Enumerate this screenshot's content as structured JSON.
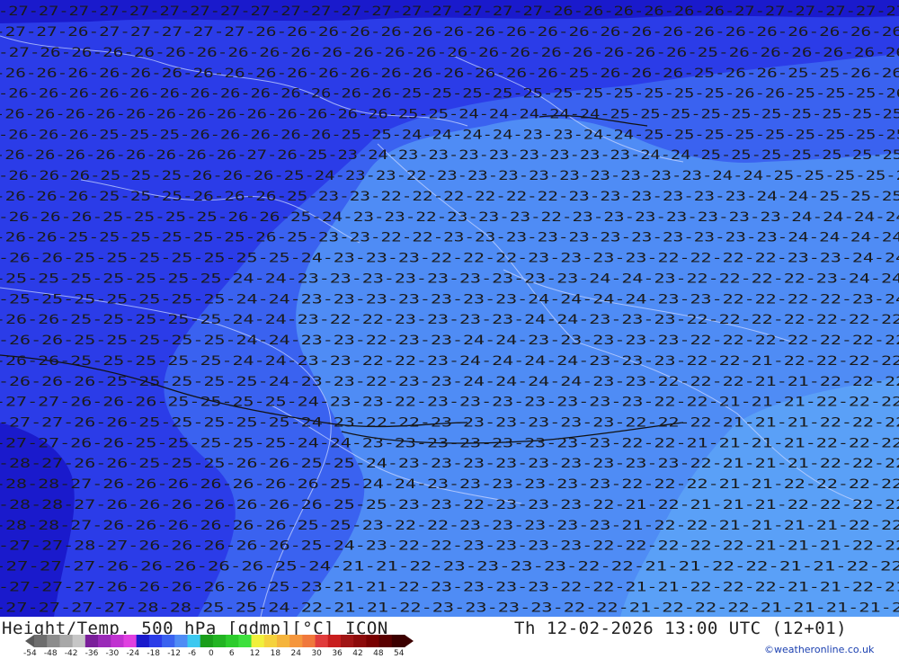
{
  "map": {
    "field": "500 hPa geopotential temperature",
    "colors": {
      "cold_deep": "#1a1acc",
      "cold_mid": "#2b3ce8",
      "blue": "#3a62f0",
      "light_blue": "#4f8cf5",
      "lighter_blue": "#5aa0f7",
      "border_line": "#c9d6ff",
      "contour_line": "#000000"
    },
    "label_rows": [
      "-27-27-27-27-27-27-27-27-27-27-27-27-27-27-27-27-27-27-26-26-26-26-26-26-27-27-27-27-27-27",
      "-27-27-26-27-27-27-27-27-26-26-26-26-26-26-26-26-26-26-26-26-26-26-26-26-26-26-26-26-26",
      "-27-26-26-26-26-26-26-26-26-26-26-26-26-26-26-26-26-26-26-26-26-26-25-26-26-26-26-26-26",
      "-26-26-26-26-26-26-26-26-26-26-26-26-26-26-26-26-26-26-25-26-26-26-25-26-26-25-25-26-26",
      "-26-26-26-26-26-26-26-26-26-26-26-26-26-25-25-25-25-25-25-25-25-25-25-25-26-26-25-25-25-26",
      "-26-26-26-26-26-26-26-26-26-26-26-26-26-25-25-24-24-24-24-24-25-25-25-25-25-25-25-25-25-25",
      "-26-26-26-25-25-25-26-26-26-26-26-25-25-24-24-24-24-23-23-24-24-25-25-25-25-25-25-25-25-25",
      "-26-26-26-26-26-26-26-26-27-26-25-23-24-23-23-23-23-23-23-23-23-24-24-25-25-25-25-25-25-25",
      "-26-26-26-25-25-25-26-26-26-25-24-23-23-22-23-23-23-23-23-23-23-23-23-24-24-25-25-25-25-2",
      "-26-26-26-25-25-25-26-26-26-25-23-23-22-22-22-22-22-22-23-23-23-23-23-23-24-24-25-25-25",
      "-26-26-26-25-25-25-25-26-26-25-24-23-23-22-23-23-23-22-23-23-23-23-23-23-23-24-24-24-24",
      "-26-26-25-25-25-25-25-25-26-25-23-23-22-22-23-23-23-23-23-23-23-23-23-23-23-24-24-24-24",
      "-26-26-25-25-25-25-25-25-25-24-23-23-23-22-22-22-23-23-23-23-22-22-22-22-23-23-24-24",
      "-25-25-25-25-25-25-25-24-24-23-23-23-23-23-23-23-23-23-24-24-23-22-22-22-22-23-24-24",
      "-25-25-25-25-25-25-25-24-24-23-23-23-23-23-23-23-24-24-24-24-23-23-22-22-22-22-23-24",
      "-26-26-25-25-25-25-25-24-24-23-22-22-23-23-23-23-24-24-23-23-23-22-22-22-22-22-22-22",
      "-26-26-25-25-25-25-25-24-24-23-23-22-23-23-24-24-23-23-23-23-23-22-22-22-22-22-22-22",
      "-26-26-25-25-25-25-25-24-24-23-23-22-22-23-24-24-24-24-23-23-23-22-22-21-22-22-22-22",
      "-26-26-26-25-25-25-25-25-24-23-23-22-23-23-24-24-24-24-23-23-22-22-22-21-21-22-22-22",
      "-27-27-26-26-26-25-25-25-25-24-23-23-22-23-23-23-23-23-23-23-22-22-21-21-21-22-22-22",
      "-27-27-26-26-25-25-25-25-25-24-23-22-22-23-23-23-23-23-23-22-22-22-21-21-21-22-22-22",
      "-27-27-26-26-25-25-25-25-25-24-24-23-23-23-23-23-23-23-23-22-22-21-21-21-21-22-22-22",
      "-28-27-26-26-25-25-25-26-26-25-25-24-23-23-23-23-23-23-23-23-23-22-21-21-21-22-22-22",
      "-28-28-27-26-26-26-26-26-26-26-25-24-24-23-23-23-23-23-23-22-22-22-21-21-22-22-22-22",
      "-28-28-27-26-26-26-26-26-26-26-25-25-23-23-22-23-23-23-22-21-22-21-21-21-22-22-22-22",
      "-28-28-27-26-26-26-26-26-26-25-25-23-22-22-23-23-23-23-23-21-22-22-21-21-21-21-22-22",
      "-27-27-28-27-26-26-26-26-26-25-24-23-22-22-23-23-23-23-22-22-22-22-22-21-21-21-22-22",
      "-27-27-27-26-26-26-26-26-25-24-21-21-22-23-23-23-23-22-22-21-21-22-22-21-21-22-22",
      "-27-27-27-26-26-26-26-26-25-23-21-21-22-23-23-23-23-22-22-21-21-22-22-22-21-21-22-21",
      "-27-27-27-27-28-28-25-25-24-22-21-21-22-23-23-23-23-22-22-21-22-22-22-21-21-21-21-2"
    ]
  },
  "footer": {
    "title": "Height/Temp. 500 hPa [gdmp][°C] ICON",
    "datetime": "Th 12-02-2026 13:00 UTC (12+01)",
    "copyright": "©weatheronline.co.uk",
    "scale_ticks": [
      "-54",
      "-48",
      "-42",
      "-36",
      "-30",
      "-24",
      "-18",
      "-12",
      "-6",
      "0",
      "6",
      "12",
      "18",
      "24",
      "30",
      "36",
      "42",
      "48",
      "54"
    ],
    "scale_colors": [
      "#6e6e6e",
      "#8c8c8c",
      "#a8a8a8",
      "#c6c6c6",
      "#7a1f9a",
      "#9a2ab8",
      "#c032d0",
      "#e040e0",
      "#1a1acc",
      "#2b3ce8",
      "#3a62f0",
      "#4f8cf5",
      "#3cc8f0",
      "#1a9e1a",
      "#22b422",
      "#2ccc2c",
      "#3ee03e",
      "#f0f03c",
      "#f5d23c",
      "#f5b43c",
      "#f5963c",
      "#f0783c",
      "#e03c3c",
      "#c81e1e",
      "#a01414",
      "#8c0a0a",
      "#780000",
      "#5a0000",
      "#3c0000"
    ]
  }
}
